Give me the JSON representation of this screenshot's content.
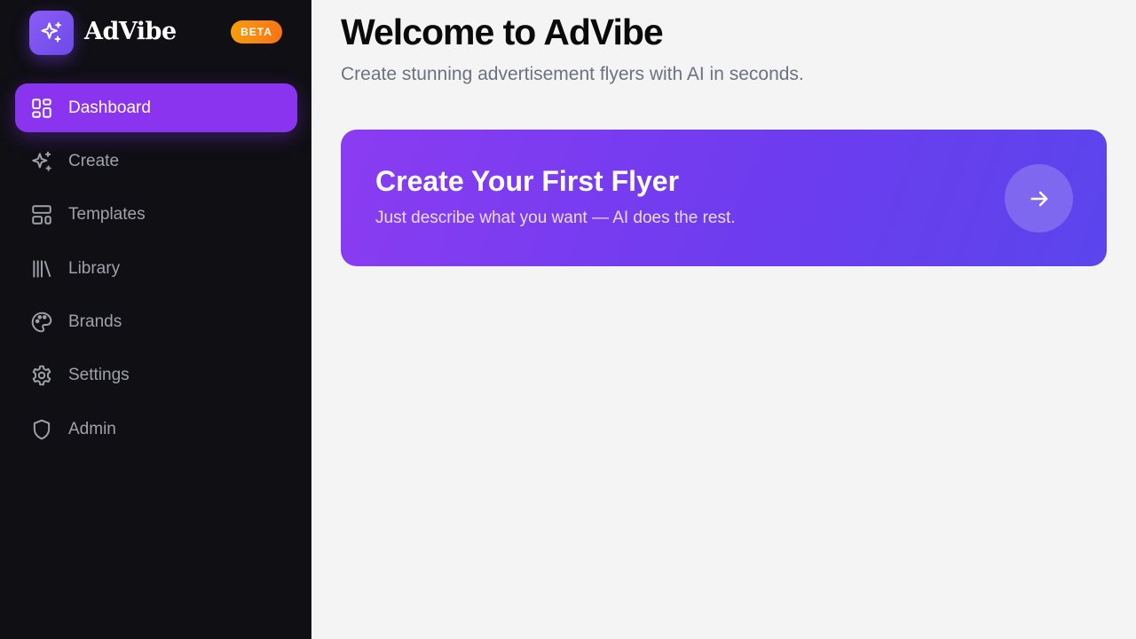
{
  "brand": {
    "name": "AdVibe",
    "badge": "BETA",
    "logo_icon": "sparkles-icon"
  },
  "sidebar": {
    "items": [
      {
        "label": "Dashboard",
        "icon": "dashboard-icon",
        "active": true
      },
      {
        "label": "Create",
        "icon": "sparkles-icon",
        "active": false
      },
      {
        "label": "Templates",
        "icon": "templates-icon",
        "active": false
      },
      {
        "label": "Library",
        "icon": "library-icon",
        "active": false
      },
      {
        "label": "Brands",
        "icon": "palette-icon",
        "active": false
      },
      {
        "label": "Settings",
        "icon": "gear-icon",
        "active": false
      },
      {
        "label": "Admin",
        "icon": "shield-icon",
        "active": false
      }
    ]
  },
  "main": {
    "title": "Welcome to AdVibe",
    "subtitle": "Create stunning advertisement flyers with AI in seconds.",
    "cta": {
      "title": "Create Your First Flyer",
      "subtitle": "Just describe what you want — AI does the rest.",
      "icon": "arrow-right-icon"
    }
  },
  "colors": {
    "sidebar_bg": "#0f0f14",
    "accent": "#8b34f0",
    "badge": "#f59e0b",
    "page_bg": "#f4f4f5"
  }
}
